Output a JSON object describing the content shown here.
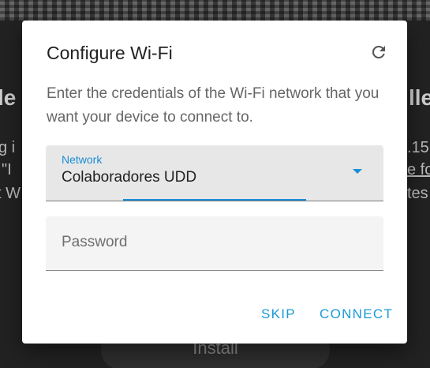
{
  "background": {
    "heading_left": "le",
    "heading_right": "lle",
    "left_lines": [
      "g i",
      " \"I",
      "t W"
    ],
    "right_lines": [
      ".15",
      "e fo",
      "tes"
    ],
    "install_label": "Install"
  },
  "dialog": {
    "title": "Configure Wi-Fi",
    "refresh_icon": "refresh-icon",
    "description": "Enter the credentials of the Wi-Fi network that you want your device to connect to.",
    "network": {
      "label": "Network",
      "value": "Colaboradores UDD"
    },
    "password": {
      "placeholder": "Password",
      "value": ""
    },
    "actions": {
      "skip": "SKIP",
      "connect": "CONNECT"
    }
  },
  "colors": {
    "accent": "#1b8ed6",
    "backdrop": "#222222",
    "dialog_bg": "#ffffff"
  }
}
